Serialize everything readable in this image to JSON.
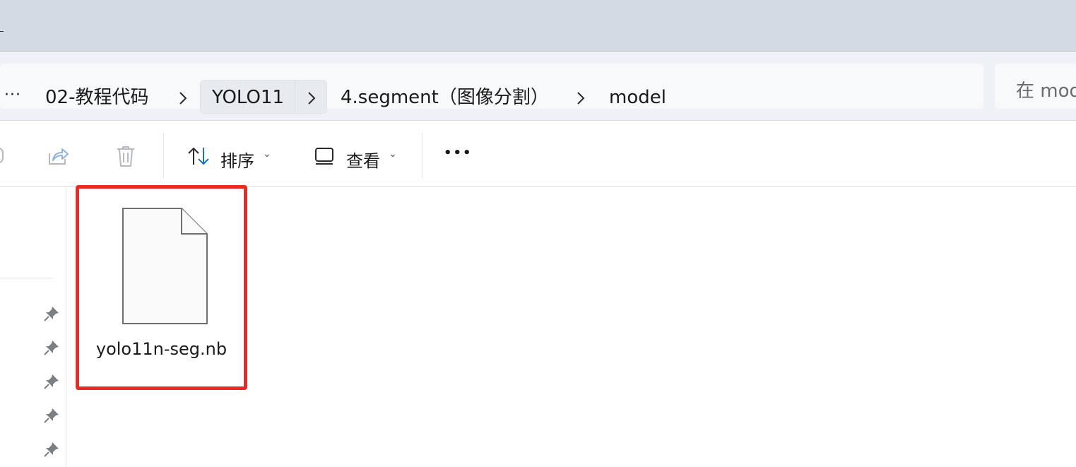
{
  "breadcrumb": {
    "more": "···",
    "items": [
      {
        "label": "02-教程代码"
      },
      {
        "label": "YOLO11"
      },
      {
        "label": "4.segment（图像分割）"
      },
      {
        "label": "model"
      }
    ],
    "separator": "›"
  },
  "search": {
    "placeholder": "在 mod"
  },
  "toolbar": {
    "sort_label": "排序",
    "view_label": "查看",
    "more_label": "•••",
    "caret": "⌄"
  },
  "files": [
    {
      "name": "yolo11n-seg.nb",
      "selected": true
    }
  ],
  "colors": {
    "highlight": "#ec2a22",
    "titlebar": "#d3dae3"
  }
}
